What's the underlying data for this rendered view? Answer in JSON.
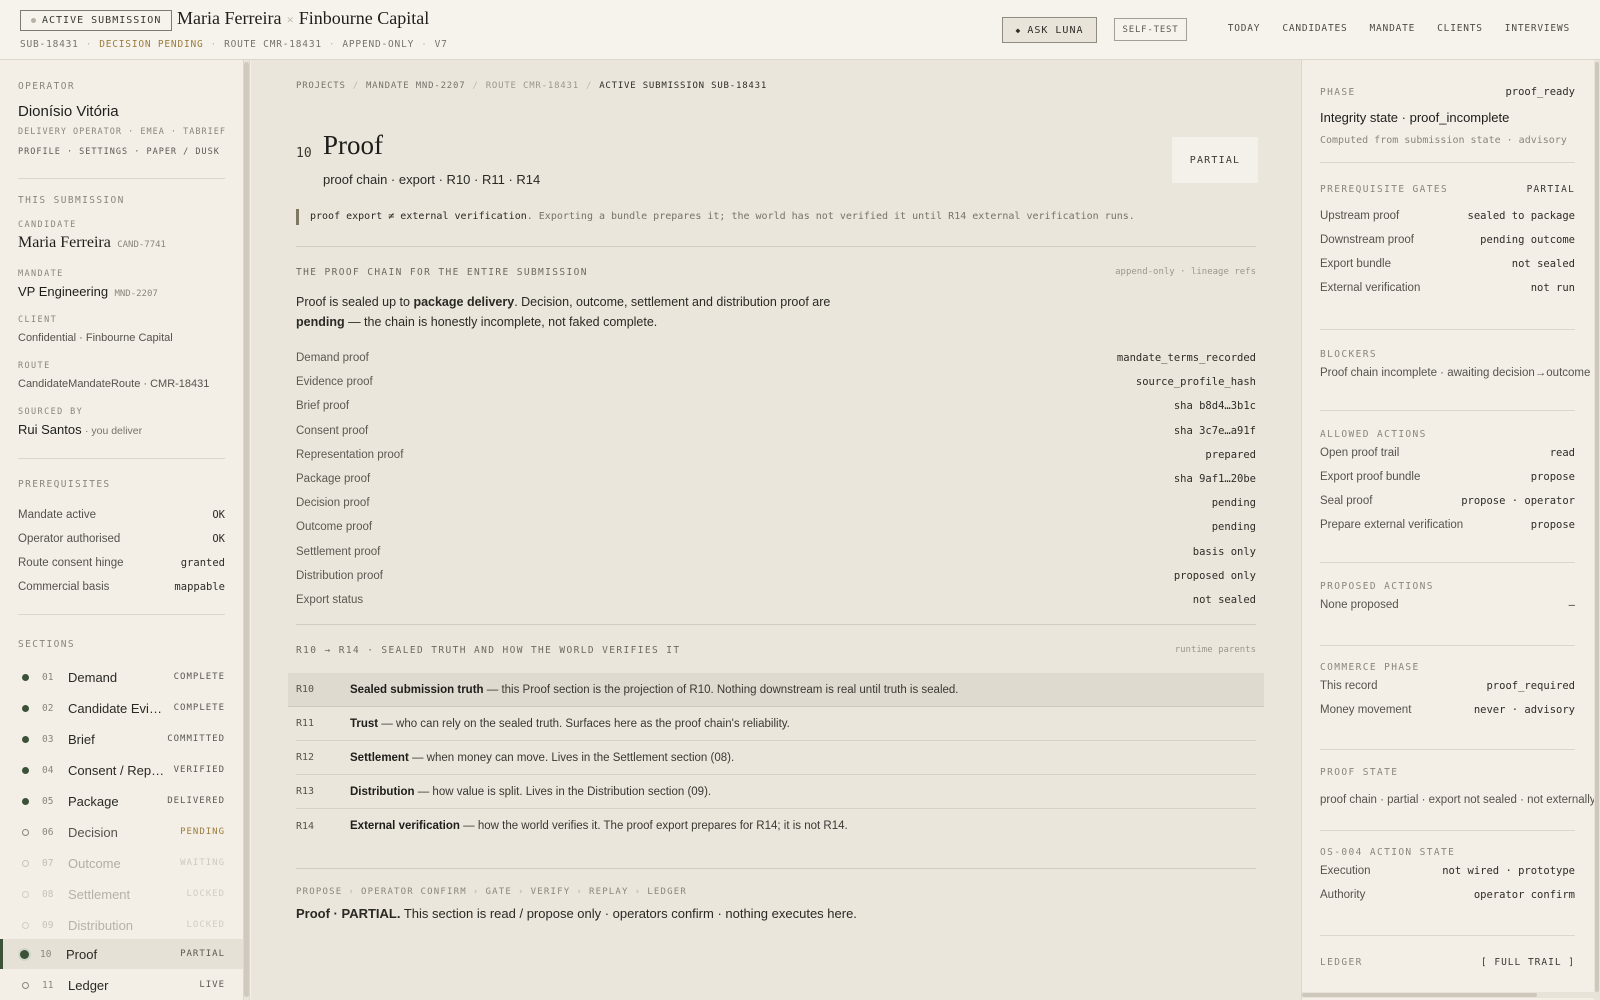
{
  "header": {
    "badge": "ACTIVE SUBMISSION",
    "candidate": "Maria Ferreira",
    "times": "×",
    "client": "Finbourne Capital",
    "sub_id": "SUB-18431",
    "status": "DECISION PENDING",
    "route": "ROUTE CMR-18431",
    "mode": "APPEND-ONLY",
    "version": "V7",
    "ask_icon": "◆",
    "ask_label": "ASK LUNA",
    "selftest_label": "SELF-TEST",
    "nav": [
      "TODAY",
      "CANDIDATES",
      "MANDATE",
      "CLIENTS",
      "INTERVIEWS"
    ]
  },
  "sidebar": {
    "operator_label": "OPERATOR",
    "operator_name": "Dionísio Vitória",
    "operator_meta": "DELIVERY OPERATOR · EMEA · TABRIEF",
    "operator_links": "PROFILE · SETTINGS · PAPER / DUSK",
    "this_submission_label": "THIS SUBMISSION",
    "candidate_label": "CANDIDATE",
    "candidate_name": "Maria Ferreira",
    "candidate_id": "CAND-7741",
    "mandate_label": "MANDATE",
    "mandate_name": "VP Engineering",
    "mandate_id": "MND-2207",
    "client_label": "CLIENT",
    "client_value": "Confidential · Finbourne Capital",
    "route_label": "ROUTE",
    "route_value": "CandidateMandateRoute · CMR-18431",
    "sourced_label": "SOURCED BY",
    "sourced_name": "Rui Santos",
    "sourced_note": "· you deliver",
    "prereq_label": "PREREQUISITES",
    "prereqs": [
      {
        "k": "Mandate active",
        "v": "OK"
      },
      {
        "k": "Operator authorised",
        "v": "OK"
      },
      {
        "k": "Route consent hinge",
        "v": "granted"
      },
      {
        "k": "Commercial basis",
        "v": "mappable"
      }
    ],
    "sections_label": "SECTIONS",
    "sections": [
      {
        "num": "01",
        "name": "Demand",
        "status": "COMPLETE"
      },
      {
        "num": "02",
        "name": "Candidate Evide…",
        "status": "COMPLETE"
      },
      {
        "num": "03",
        "name": "Brief",
        "status": "COMMITTED"
      },
      {
        "num": "04",
        "name": "Consent / Repre…",
        "status": "VERIFIED"
      },
      {
        "num": "05",
        "name": "Package",
        "status": "DELIVERED"
      },
      {
        "num": "06",
        "name": "Decision",
        "status": "PENDING"
      },
      {
        "num": "07",
        "name": "Outcome",
        "status": "WAITING"
      },
      {
        "num": "08",
        "name": "Settlement",
        "status": "LOCKED"
      },
      {
        "num": "09",
        "name": "Distribution",
        "status": "LOCKED"
      },
      {
        "num": "10",
        "name": "Proof",
        "status": "PARTIAL"
      },
      {
        "num": "11",
        "name": "Ledger",
        "status": "LIVE"
      }
    ]
  },
  "main": {
    "breadcrumb": [
      "PROJECTS",
      "MANDATE MND-2207",
      "ROUTE CMR-18431",
      "ACTIVE SUBMISSION SUB-18431"
    ],
    "breadcrumb_sep": "/",
    "section_num": "10",
    "section_title": "Proof",
    "section_sub": "proof chain · export · R10 · R11 · R14",
    "state_badge": "PARTIAL",
    "note_code": "proof export ≠ external verification",
    "note_rest": ". Exporting a bundle prepares it; the world has not verified it until R14 external verification runs.",
    "chain_head": "THE PROOF CHAIN FOR THE ENTIRE SUBMISSION",
    "chain_head_right": "append-only · lineage refs",
    "chain_p1": "Proof is sealed up to ",
    "chain_b1": "package delivery",
    "chain_p2": ". Decision, outcome, settlement and distribution proof are ",
    "chain_b2": "pending",
    "chain_p3": " — the chain is honestly incomplete, not faked complete.",
    "proofs": [
      {
        "k": "Demand proof",
        "v": "mandate_terms_recorded"
      },
      {
        "k": "Evidence proof",
        "v": "source_profile_hash"
      },
      {
        "k": "Brief proof",
        "v": "sha b8d4…3b1c"
      },
      {
        "k": "Consent proof",
        "v": "sha 3c7e…a91f"
      },
      {
        "k": "Representation proof",
        "v": "prepared"
      },
      {
        "k": "Package proof",
        "v": "sha 9af1…20be"
      },
      {
        "k": "Decision proof",
        "v": "pending"
      },
      {
        "k": "Outcome proof",
        "v": "pending"
      },
      {
        "k": "Settlement proof",
        "v": "basis only"
      },
      {
        "k": "Distribution proof",
        "v": "proposed only"
      },
      {
        "k": "Export status",
        "v": "not sealed"
      }
    ],
    "runtime_head": "R10 → R14 · SEALED TRUTH AND HOW THE WORLD VERIFIES IT",
    "runtime_head_right": "runtime parents",
    "runtime": [
      {
        "id": "R10",
        "title": "Sealed submission truth",
        "desc": " — this Proof section is the projection of R10. Nothing downstream is real until truth is sealed."
      },
      {
        "id": "R11",
        "title": "Trust",
        "desc": " — who can rely on the sealed truth. Surfaces here as the proof chain's reliability."
      },
      {
        "id": "R12",
        "title": "Settlement",
        "desc": " — when money can move. Lives in the Settlement section (08)."
      },
      {
        "id": "R13",
        "title": "Distribution",
        "desc": " — how value is split. Lives in the Distribution section (09)."
      },
      {
        "id": "R14",
        "title": "External verification",
        "desc": " — how the world verifies it. The proof export prepares for R14; it is not R14."
      }
    ],
    "flow": [
      "PROPOSE",
      "OPERATOR CONFIRM",
      "GATE",
      "VERIFY",
      "REPLAY",
      "LEDGER"
    ],
    "flow_sep": "›",
    "footer_bold": "Proof · PARTIAL.",
    "footer_rest": " This section is read / propose only · operators confirm · nothing executes here."
  },
  "right": {
    "phase_label": "PHASE",
    "phase_value": "proof_ready",
    "integrity_prefix": "Integrity state · ",
    "integrity_value": "proof_incomplete",
    "computed_note": "Computed from submission state · advisory",
    "gates_label": "PREREQUISITE GATES",
    "gates_state": "PARTIAL",
    "gates": [
      {
        "k": "Upstream proof",
        "v": "sealed to package"
      },
      {
        "k": "Downstream proof",
        "v": "pending outcome"
      },
      {
        "k": "Export bundle",
        "v": "not sealed"
      },
      {
        "k": "External verification",
        "v": "not run"
      }
    ],
    "blockers_label": "BLOCKERS",
    "blockers_text": "Proof chain incomplete · awaiting decision→outcome",
    "allowed_label": "ALLOWED ACTIONS",
    "allowed": [
      {
        "k": "Open proof trail",
        "v": "read"
      },
      {
        "k": "Export proof bundle",
        "v": "propose"
      },
      {
        "k": "Seal proof",
        "v": "propose · operator"
      },
      {
        "k": "Prepare external verification",
        "v": "propose"
      }
    ],
    "proposed_label": "PROPOSED ACTIONS",
    "proposed_text": "None proposed",
    "proposed_dash": "–",
    "commerce_label": "COMMERCE PHASE",
    "commerce": [
      {
        "k": "This record",
        "v": "proof_required"
      },
      {
        "k": "Money movement",
        "v": "never · advisory"
      }
    ],
    "proofstate_label": "PROOF STATE",
    "proofstate_text": "proof chain · partial · export not sealed · not externally verified",
    "os_label": "OS-004 ACTION STATE",
    "os": [
      {
        "k": "Execution",
        "v": "not wired · prototype"
      },
      {
        "k": "Authority",
        "v": "operator confirm"
      }
    ],
    "ledger_label": "LEDGER",
    "ledger_link": "[ FULL TRAIL ]"
  },
  "colors": {
    "accent_green": "#3b5238",
    "pending_gold": "#9a7d3c",
    "paper": "#f3efe7",
    "main_bg": "#ebe6dc"
  }
}
